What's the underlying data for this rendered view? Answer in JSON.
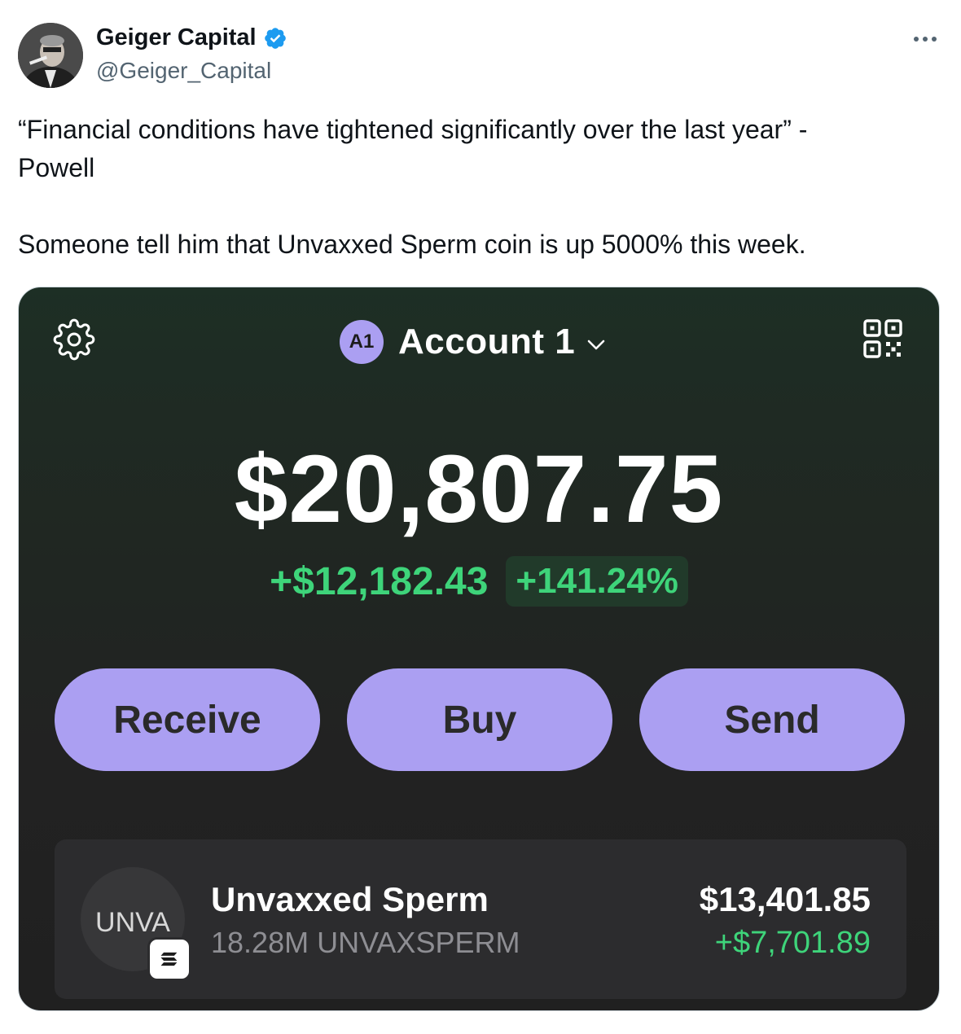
{
  "author": {
    "display_name": "Geiger Capital",
    "handle": "@Geiger_Capital",
    "verified": true
  },
  "tweet": {
    "line1": "“Financial conditions have tightened significantly over the last year” -",
    "line2": "Powell",
    "line3": "Someone tell him that Unvaxxed Sperm coin is up 5000% this week."
  },
  "wallet": {
    "account_badge": "A1",
    "account_name": "Account 1",
    "balance": "$20,807.75",
    "change_amount": "+$12,182.43",
    "change_percent": "+141.24%",
    "actions": {
      "receive": "Receive",
      "buy": "Buy",
      "send": "Send"
    },
    "token": {
      "logo_text": "UNVA",
      "name": "Unvaxxed Sperm",
      "amount": "18.28M UNVAXSPERM",
      "value": "$13,401.85",
      "change": "+$7,701.89"
    }
  },
  "icons": {
    "verified": "verified-badge-icon",
    "more": "more-icon",
    "settings": "gear-icon",
    "account_menu": "chevron-down-icon",
    "qr": "qr-code-icon",
    "chain": "solana-icon"
  },
  "colors": {
    "accent_purple": "#ab9ff2",
    "gain_green": "#3ed47a",
    "verified_blue": "#1d9bf0"
  }
}
